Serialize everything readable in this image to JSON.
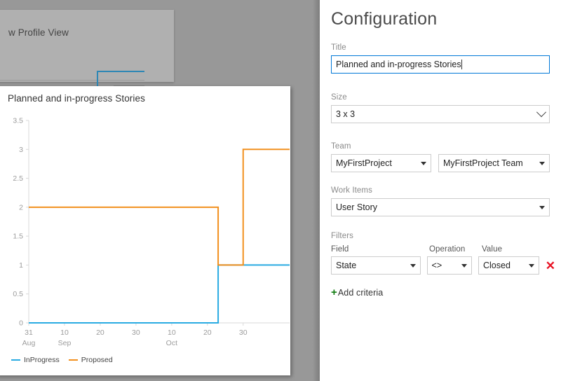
{
  "backdrop": {
    "card_title": "w Profile View"
  },
  "chart_card": {
    "title": "Planned and in-progress Stories"
  },
  "chart_data": {
    "type": "line",
    "title": "Planned and in-progress Stories",
    "step": true,
    "xlabel": "",
    "ylabel": "",
    "ylim": [
      0,
      3.5
    ],
    "y_ticks": [
      "0",
      "0.5",
      "1",
      "1.5",
      "2",
      "2.5",
      "3",
      "3.5"
    ],
    "y_tick_values": [
      0,
      0.5,
      1,
      1.5,
      2,
      2.5,
      3,
      3.5
    ],
    "grid": false,
    "legend_position": "bottom-left",
    "x_ticks": [
      {
        "day": "31",
        "month": "Aug",
        "value": 0
      },
      {
        "day": "10",
        "month": "Sep",
        "value": 10
      },
      {
        "day": "20",
        "month": "",
        "value": 20
      },
      {
        "day": "30",
        "month": "",
        "value": 30
      },
      {
        "day": "10",
        "month": "Oct",
        "value": 40
      },
      {
        "day": "20",
        "month": "",
        "value": 50
      },
      {
        "day": "30",
        "month": "",
        "value": 60
      }
    ],
    "x_range": [
      0,
      73
    ],
    "series": [
      {
        "name": "InProgress",
        "color": "#29ABE2",
        "points": [
          [
            0,
            0
          ],
          [
            53,
            0
          ],
          [
            53,
            1
          ],
          [
            73,
            1
          ]
        ]
      },
      {
        "name": "Proposed",
        "color": "#F2901E",
        "points": [
          [
            0,
            2
          ],
          [
            53,
            2
          ],
          [
            53,
            1
          ],
          [
            60,
            1
          ],
          [
            60,
            3
          ],
          [
            73,
            3
          ]
        ]
      }
    ]
  },
  "config": {
    "heading": "Configuration",
    "title_label": "Title",
    "title_value": "Planned and in-progress Stories",
    "size_label": "Size",
    "size_value": "3 x 3",
    "team_label": "Team",
    "project_value": "MyFirstProject",
    "team_value": "MyFirstProject Team",
    "work_items_label": "Work Items",
    "work_items_value": "User Story",
    "filters_label": "Filters",
    "field_label": "Field",
    "operation_label": "Operation",
    "value_label": "Value",
    "filter_field_value": "State",
    "filter_operation_value": "<>",
    "filter_value_value": "Closed",
    "remove_icon": "✕",
    "add_criteria_label": "Add criteria",
    "add_criteria_plus": "+",
    "accent_color": "#0078d7",
    "remove_color": "#e81123",
    "add_color": "#107c10"
  }
}
